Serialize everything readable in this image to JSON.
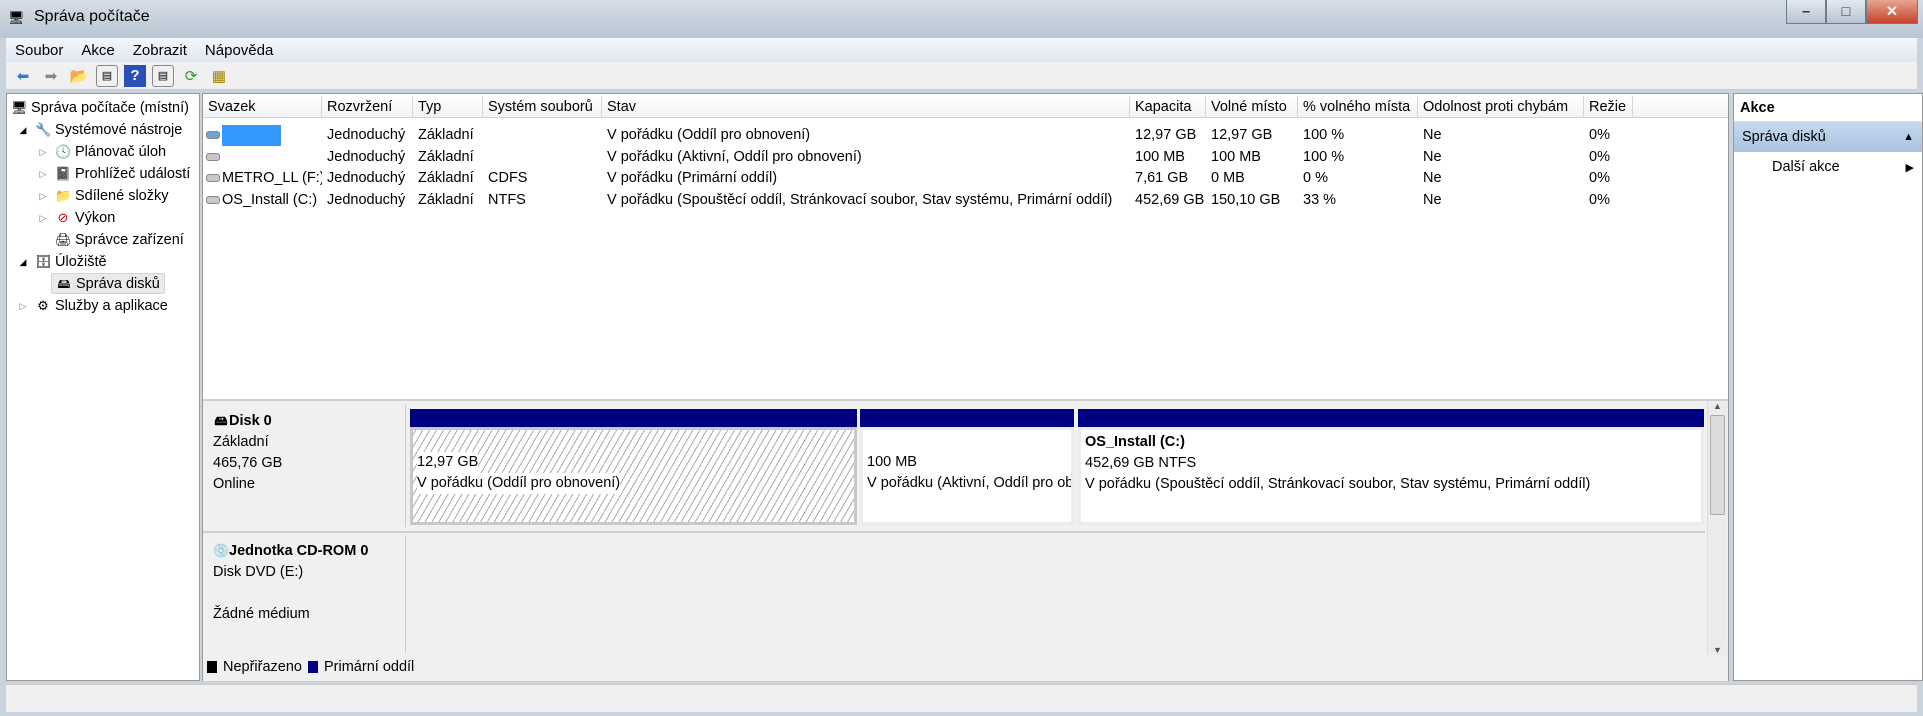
{
  "window": {
    "title": "Správa počítače",
    "minimize": "–",
    "maximize": "□",
    "close": "✕"
  },
  "menu": [
    "Soubor",
    "Akce",
    "Zobrazit",
    "Nápověda"
  ],
  "tree": {
    "root": "Správa počítače (místní)",
    "items": [
      {
        "label": "Systémové nástroje",
        "expander": "◢",
        "icon": "🔧"
      },
      {
        "label": "Plánovač úloh",
        "expander": "▷",
        "icon": "🕓"
      },
      {
        "label": "Prohlížeč událostí",
        "expander": "▷",
        "icon": "📓"
      },
      {
        "label": "Sdílené složky",
        "expander": "▷",
        "icon": "📁"
      },
      {
        "label": "Výkon",
        "expander": "▷",
        "icon": "⊘"
      },
      {
        "label": "Správce zařízení",
        "expander": "",
        "icon": "🖨"
      },
      {
        "label": "Úložiště",
        "expander": "◢",
        "icon": "🗄"
      },
      {
        "label": "Správa disků",
        "expander": "",
        "icon": "🖴"
      },
      {
        "label": "Služby a aplikace",
        "expander": "▷",
        "icon": "⚙"
      }
    ]
  },
  "table": {
    "columns": [
      "Svazek",
      "Rozvržení",
      "Typ",
      "Systém souborů",
      "Stav",
      "Kapacita",
      "Volné místo",
      "% volného místa",
      "Odolnost proti chybám",
      "Režie"
    ],
    "rows": [
      [
        "",
        "Jednoduchý",
        "Základní",
        "",
        "V pořádku (Oddíl pro obnovení)",
        "12,97 GB",
        "12,97 GB",
        "100 %",
        "Ne",
        "0%"
      ],
      [
        "",
        "Jednoduchý",
        "Základní",
        "",
        "V pořádku (Aktivní, Oddíl pro obnovení)",
        "100 MB",
        "100 MB",
        "100 %",
        "Ne",
        "0%"
      ],
      [
        "METRO_LL (F:)",
        "Jednoduchý",
        "Základní",
        "CDFS",
        "V pořádku (Primární oddíl)",
        "7,61 GB",
        "0 MB",
        "0 %",
        "Ne",
        "0%"
      ],
      [
        "OS_Install (C:)",
        "Jednoduchý",
        "Základní",
        "NTFS",
        "V pořádku (Spouštěcí oddíl, Stránkovací soubor, Stav systému, Primární oddíl)",
        "452,69 GB",
        "150,10 GB",
        "33 %",
        "Ne",
        "0%"
      ]
    ]
  },
  "disks": [
    {
      "name": "Disk 0",
      "type": "Základní",
      "size": "465,76 GB",
      "status": "Online",
      "partitions": [
        {
          "name": "",
          "size": "12,97 GB",
          "status": "V pořádku (Oddíl pro obnovení)"
        },
        {
          "name": "",
          "size": "100 MB",
          "status": "V pořádku (Aktivní, Oddíl pro obnovení)"
        },
        {
          "name": "OS_Install  (C:)",
          "size": "452,69 GB NTFS",
          "status": "V pořádku (Spouštěcí oddíl, Stránkovací soubor, Stav systému, Primární oddíl)"
        }
      ]
    },
    {
      "name": "Jednotka CD-ROM 0",
      "type": "Disk DVD (E:)",
      "status": "Žádné médium"
    }
  ],
  "legend": [
    {
      "label": "Nepřiřazeno",
      "color": "#000000"
    },
    {
      "label": "Primární oddíl",
      "color": "#000080"
    }
  ],
  "actions": {
    "title": "Akce",
    "section": "Správa disků",
    "item": "Další akce"
  }
}
